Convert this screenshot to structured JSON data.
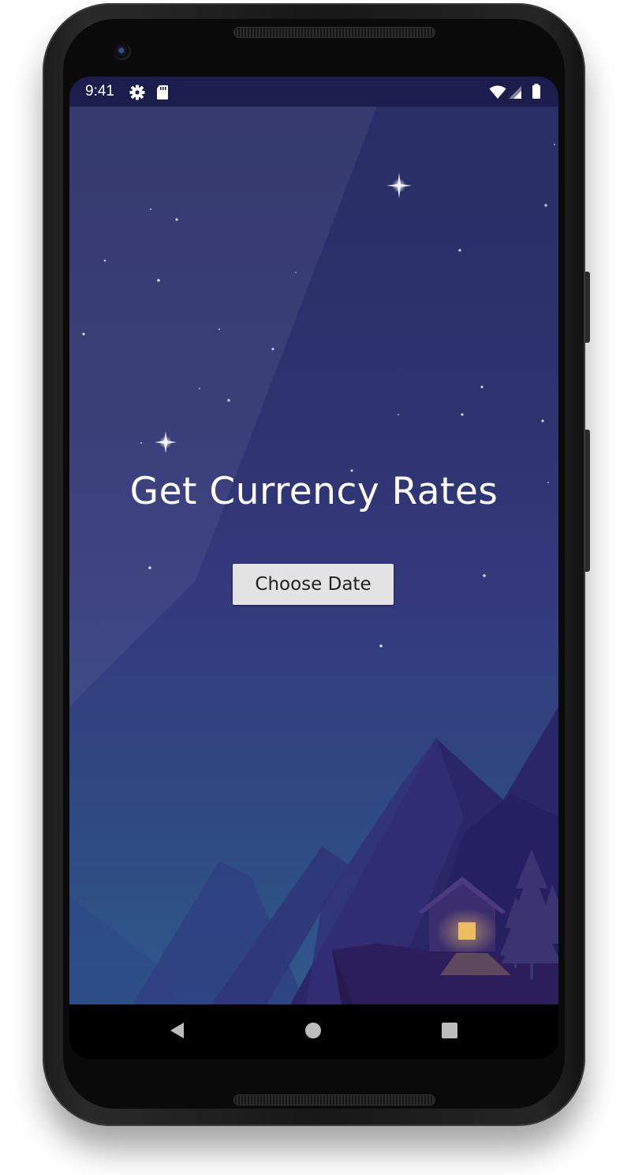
{
  "status_bar": {
    "time": "9:41",
    "icons": [
      "gear-icon",
      "sd-card-icon",
      "wifi-icon",
      "cellular-signal-icon",
      "battery-icon"
    ]
  },
  "app": {
    "title": "Get Currency Rates",
    "choose_date_button": "Choose Date",
    "background": "night-mountain-scene"
  },
  "nav_bar": {
    "buttons": [
      "back",
      "home",
      "recents"
    ]
  },
  "colors": {
    "status_bar": "#1b1e4c",
    "background_top": "#2a2e66",
    "background_bottom": "#2f5a8a",
    "button_bg": "#e3e3e3",
    "title_text": "#ffffff",
    "window_light": "#e6b55a"
  }
}
